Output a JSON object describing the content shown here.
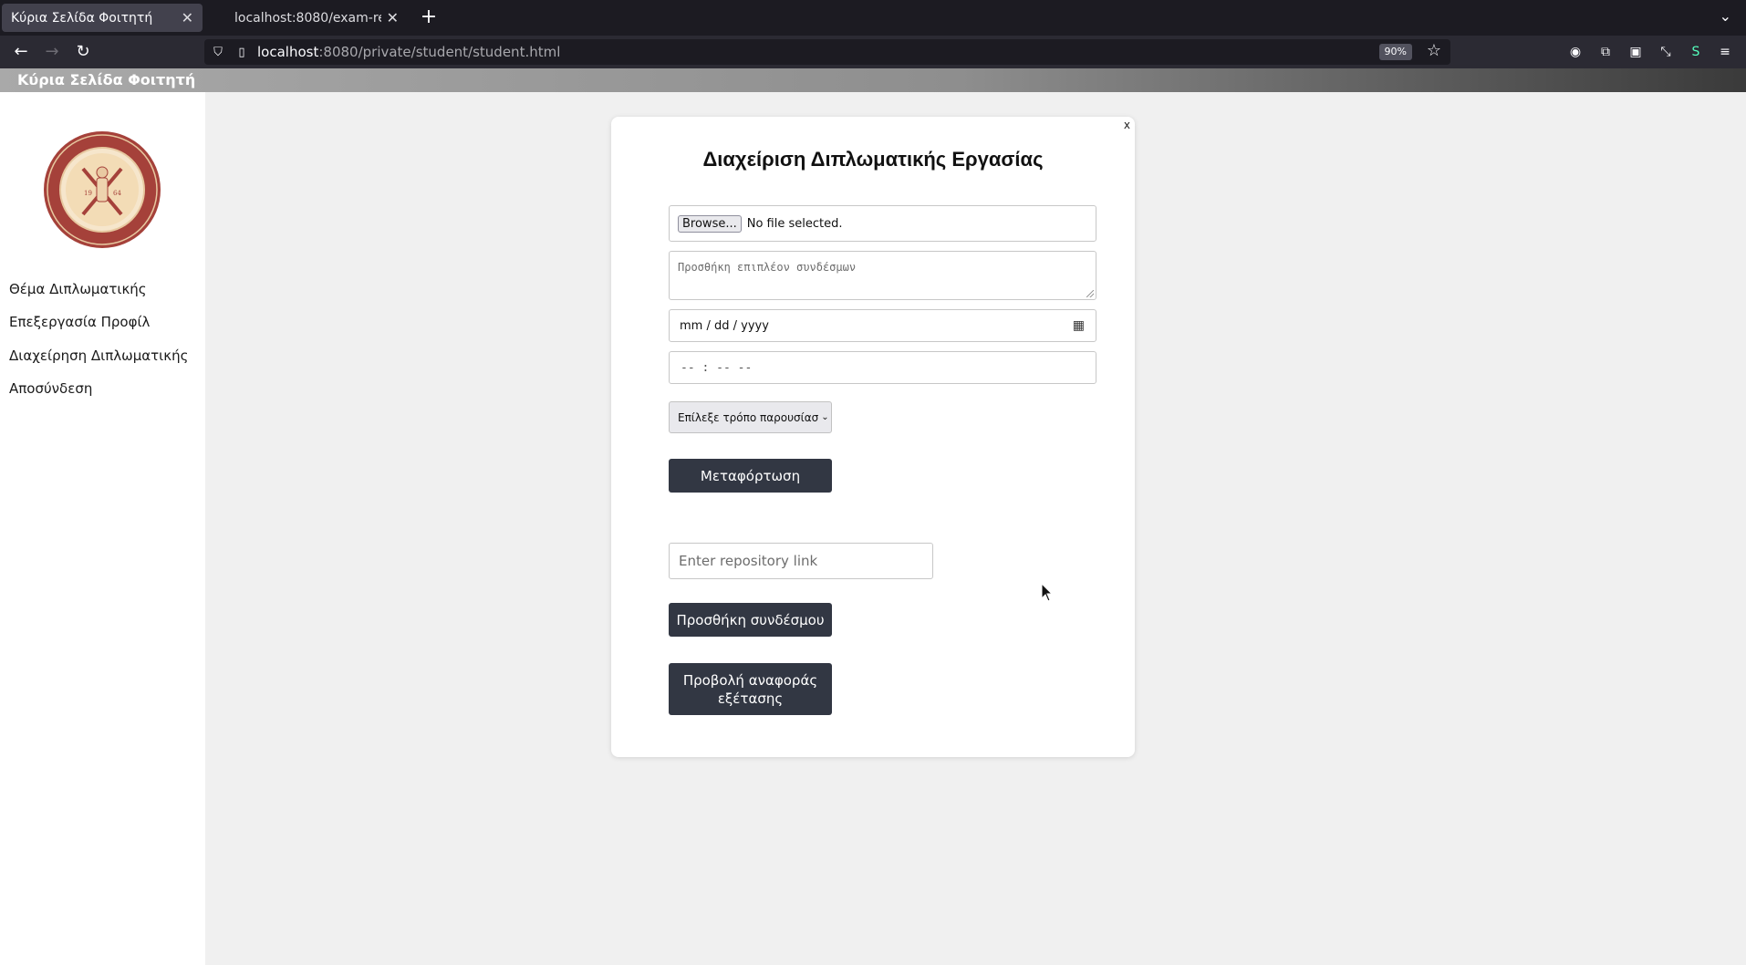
{
  "browser": {
    "tabs": [
      {
        "title": "Κύρια Σελίδα Φοιτητή",
        "active": true
      },
      {
        "title": "localhost:8080/exam-repor",
        "active": false
      }
    ],
    "url_host": "localhost",
    "url_path": ":8080/private/student/student.html",
    "zoom": "90%"
  },
  "page": {
    "header_title": "Κύρια Σελίδα Φοιτητή"
  },
  "sidebar": {
    "logo_text": "ΠΑΝΕΠΙΣΤΗΜΙΟ ΠΑΤΡΩΝ UNIVERSITY OF PATRAS 1964",
    "items": [
      {
        "label": "Θέμα Διπλωματικής"
      },
      {
        "label": "Επεξεργασία Προφίλ"
      },
      {
        "label": "Διαχείρηση Διπλωματικής"
      },
      {
        "label": "Αποσύνδεση"
      }
    ]
  },
  "modal": {
    "close_label": "x",
    "title": "Διαχείριση Διπλωματικής Εργασίας",
    "browse_label": "Browse...",
    "file_status": "No file selected.",
    "links_placeholder": "Προσθήκη επιπλέον συνδέσμων",
    "date_placeholder": "mm / dd / yyyy",
    "time_placeholder": "-- : --  --",
    "presentation_select": "Επίλεξε τρόπο παρουσίασ",
    "upload_button": "Μεταφόρτωση",
    "repo_placeholder": "Enter repository link",
    "add_link_button": "Προσθήκη συνδέσμου",
    "report_button": "Προβολή αναφοράς εξέτασης"
  },
  "colors": {
    "button_bg": "#323743",
    "page_bg": "#f0f0f0",
    "chrome_bg": "#2b2a33"
  }
}
